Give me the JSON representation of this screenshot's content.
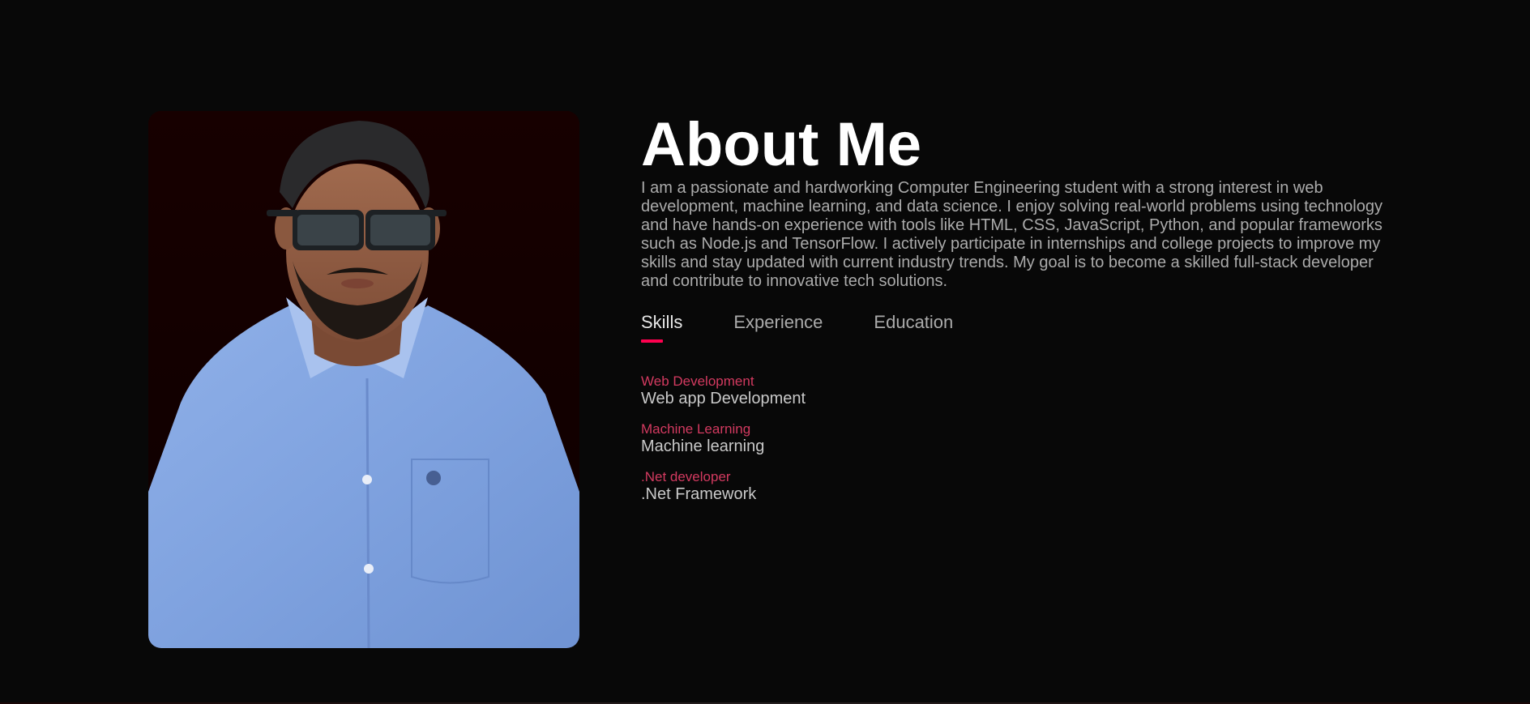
{
  "about": {
    "title": "About Me",
    "bio": "I am a passionate and hardworking Computer Engineering student with a strong interest in web development, machine learning, and data science. I enjoy solving real-world problems using technology and have hands-on experience with tools like HTML, CSS, JavaScript, Python, and popular frameworks such as Node.js and TensorFlow. I actively participate in internships and college projects to improve my skills and stay updated with current industry trends. My goal is to become a skilled full-stack developer and contribute to innovative tech solutions."
  },
  "tabs": [
    {
      "label": "Skills",
      "active": true
    },
    {
      "label": "Experience",
      "active": false
    },
    {
      "label": "Education",
      "active": false
    }
  ],
  "skills": [
    {
      "title": "Web Development",
      "desc": "Web app Development"
    },
    {
      "title": "Machine Learning",
      "desc": "Machine learning"
    },
    {
      "title": ".Net developer",
      "desc": ".Net Framework"
    }
  ],
  "colors": {
    "background": "#080808",
    "accent": "#ff004f",
    "skill_title": "#d33a60",
    "body_text": "#ababab",
    "heading": "#ffffff"
  }
}
